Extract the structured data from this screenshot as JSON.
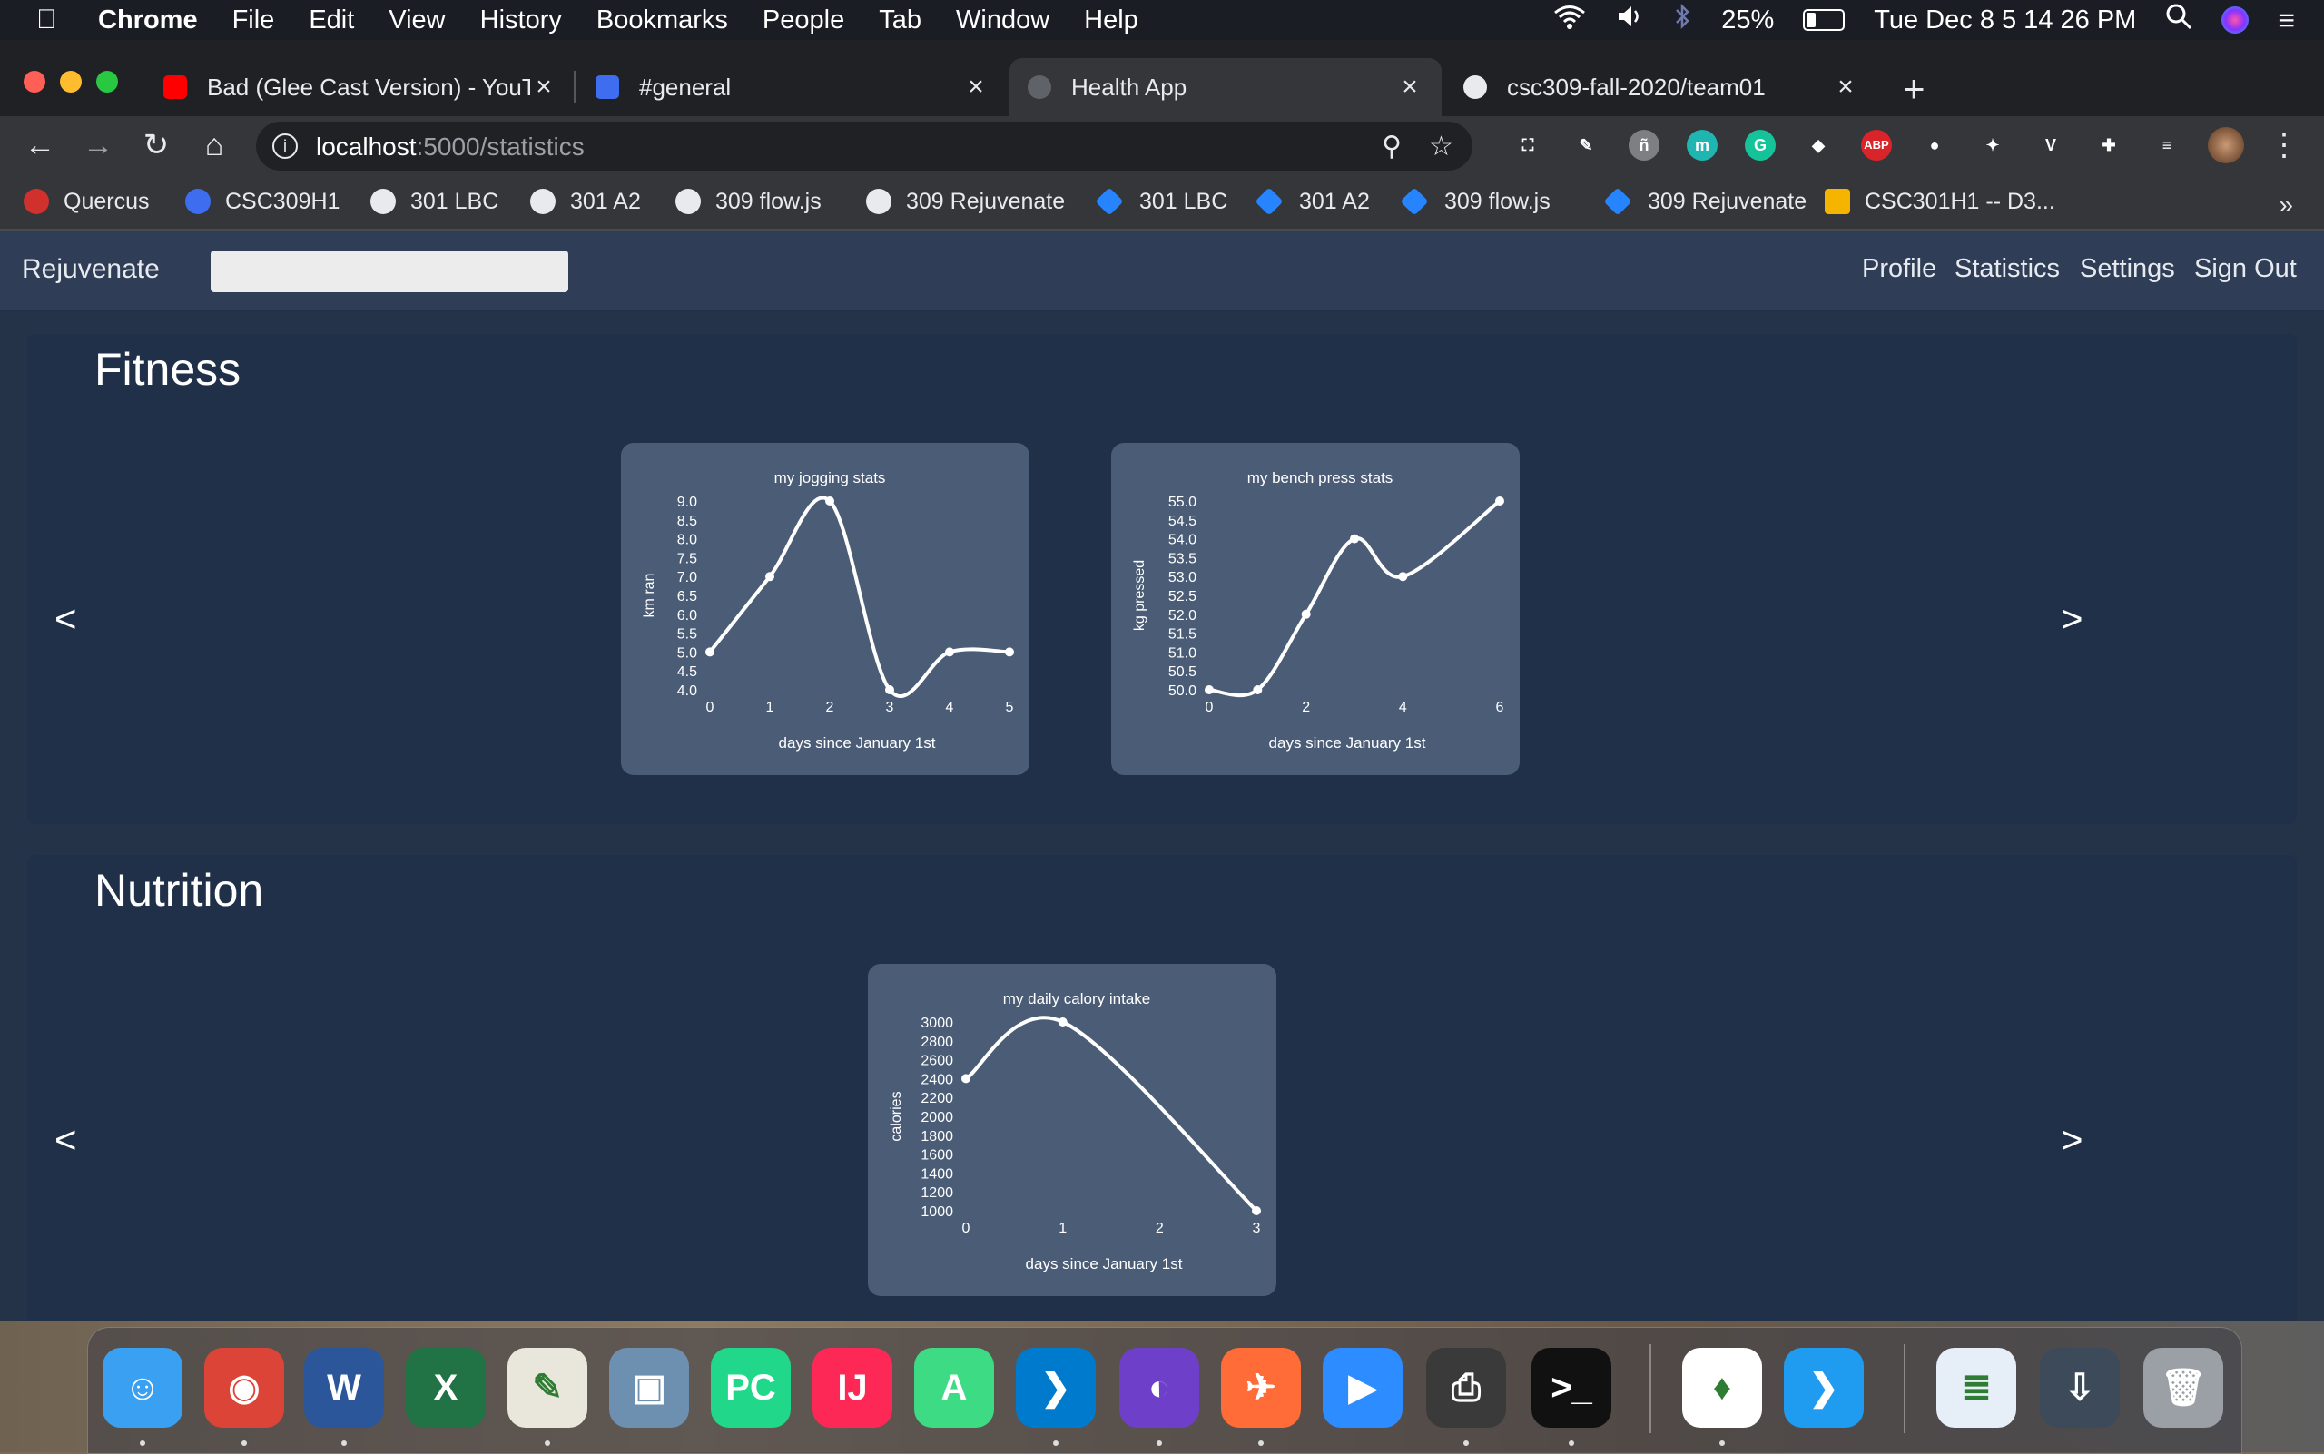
{
  "menubar": {
    "app": "Chrome",
    "items": [
      "File",
      "Edit",
      "View",
      "History",
      "Bookmarks",
      "People",
      "Tab",
      "Window",
      "Help"
    ],
    "battery_pct": "25%",
    "battery_level": 0.25,
    "datetime": "Tue Dec 8  5 14 26 PM"
  },
  "tabs": [
    {
      "title": "Bad (Glee Cast Version) - YouTube",
      "icon": "youtube-icon",
      "color": "#ff0000"
    },
    {
      "title": "#general",
      "icon": "slack-icon",
      "color": "#3f6df0"
    },
    {
      "title": "Health App",
      "icon": "globe-icon",
      "color": "#5f6368"
    },
    {
      "title": "csc309-fall-2020/team01",
      "icon": "github-icon",
      "color": "#e8eaed"
    }
  ],
  "omnibox": {
    "host": "localhost",
    "path": ":5000/statistics"
  },
  "extensions": [
    {
      "icon": "screenshot-ext-icon",
      "label": "⛶",
      "color": "#35363a"
    },
    {
      "icon": "pencil-ext-icon",
      "label": "✎",
      "color": "#35363a"
    },
    {
      "icon": "ext-tile-icon",
      "label": "ñ",
      "color": "#7d7f83"
    },
    {
      "icon": "mendeley-ext-icon",
      "label": "m",
      "color": "#1fb5b0"
    },
    {
      "icon": "grammarly-ext-icon",
      "label": "G",
      "color": "#15c39a"
    },
    {
      "icon": "diamond-ext-icon",
      "label": "◆",
      "color": "#35363a"
    },
    {
      "icon": "adblock-ext-icon",
      "label": "ABP",
      "color": "#d9252a"
    },
    {
      "icon": "toggle-ext-icon",
      "label": "●",
      "color": "#35363a"
    },
    {
      "icon": "react-devtools-icon",
      "label": "✦",
      "color": "#35363a"
    },
    {
      "icon": "vue-devtools-icon",
      "label": "V",
      "color": "#35363a"
    },
    {
      "icon": "puzzle-icon",
      "label": "✚",
      "color": "#35363a"
    },
    {
      "icon": "media-control-icon",
      "label": "≡",
      "color": "#35363a"
    }
  ],
  "bookmarks": [
    {
      "label": "Quercus",
      "icon": "quercus-icon",
      "kind": "dot",
      "color": "#d0312d"
    },
    {
      "label": "CSC309H1",
      "icon": "piazza-icon",
      "kind": "dot",
      "color": "#3f6df0"
    },
    {
      "label": "301 LBC",
      "icon": "github-icon",
      "kind": "gh"
    },
    {
      "label": "301 A2",
      "icon": "github-icon",
      "kind": "gh"
    },
    {
      "label": "309 flow.js",
      "icon": "github-icon",
      "kind": "gh"
    },
    {
      "label": "309 Rejuvenate",
      "icon": "github-icon",
      "kind": "gh"
    },
    {
      "label": "301 LBC",
      "icon": "jira-icon",
      "kind": "jira"
    },
    {
      "label": "301 A2",
      "icon": "jira-icon",
      "kind": "jira"
    },
    {
      "label": "309 flow.js",
      "icon": "jira-icon",
      "kind": "jira"
    },
    {
      "label": "309 Rejuvenate",
      "icon": "jira-icon",
      "kind": "jira"
    },
    {
      "label": "CSC301H1 -- D3...",
      "icon": "slides-icon",
      "kind": "slides",
      "color": "#f4b400"
    }
  ],
  "app": {
    "brand": "Rejuvenate",
    "nav": [
      "Profile",
      "Statistics",
      "Settings",
      "Sign Out"
    ]
  },
  "sections": {
    "fitness": {
      "title": "Fitness",
      "prev": "<",
      "next": ">"
    },
    "nutrition": {
      "title": "Nutrition",
      "prev": "<",
      "next": ">"
    }
  },
  "chart_data": [
    {
      "type": "line",
      "title": "my jogging stats",
      "xlabel": "days since January 1st",
      "ylabel": "km ran",
      "x": [
        0,
        1,
        2,
        3,
        4,
        5
      ],
      "y": [
        5.0,
        7.0,
        9.0,
        4.0,
        5.0,
        5.0
      ],
      "xlim": [
        0,
        5
      ],
      "ylim": [
        4.0,
        9.0
      ],
      "xticks": [
        "0",
        "1",
        "2",
        "3",
        "4",
        "5"
      ],
      "yticks": [
        "9.0",
        "8.5",
        "8.0",
        "7.5",
        "7.0",
        "6.5",
        "6.0",
        "5.5",
        "5.0",
        "4.5",
        "4.0"
      ],
      "line_color": "#ffffff",
      "grid": false
    },
    {
      "type": "line",
      "title": "my bench press stats",
      "xlabel": "days since January 1st",
      "ylabel": "kg pressed",
      "x": [
        0,
        1,
        2,
        3,
        4,
        6
      ],
      "y": [
        50.0,
        50.0,
        52.0,
        54.0,
        53.0,
        55.0
      ],
      "xlim": [
        0,
        6
      ],
      "ylim": [
        50.0,
        55.0
      ],
      "xticks": [
        "0",
        "2",
        "4",
        "6"
      ],
      "yticks": [
        "55.0",
        "54.5",
        "54.0",
        "53.5",
        "53.0",
        "52.5",
        "52.0",
        "51.5",
        "51.0",
        "50.5",
        "50.0"
      ],
      "line_color": "#ffffff",
      "grid": false
    },
    {
      "type": "line",
      "title": "my daily calory intake",
      "xlabel": "days since January 1st",
      "ylabel": "calories",
      "x": [
        0,
        1,
        3
      ],
      "y": [
        2400,
        3000,
        1000
      ],
      "xlim": [
        0,
        3
      ],
      "ylim": [
        1000,
        3000
      ],
      "xticks": [
        "0",
        "1",
        "2",
        "3"
      ],
      "yticks": [
        "3000",
        "2800",
        "2600",
        "2400",
        "2200",
        "2000",
        "1800",
        "1600",
        "1400",
        "1200",
        "1000"
      ],
      "line_color": "#ffffff",
      "grid": false
    }
  ],
  "dock": [
    {
      "name": "finder-icon",
      "label": "☺",
      "color": "#3aa0f2",
      "running": true
    },
    {
      "name": "chrome-icon",
      "label": "◉",
      "color": "#db4437",
      "running": true
    },
    {
      "name": "word-icon",
      "label": "W",
      "color": "#2b579a",
      "running": true
    },
    {
      "name": "excel-icon",
      "label": "X",
      "color": "#217346",
      "running": false
    },
    {
      "name": "textedit-icon",
      "label": "✎",
      "color": "#e9e6dc",
      "running": true
    },
    {
      "name": "preview-icon",
      "label": "▣",
      "color": "#6d8fb0",
      "running": false
    },
    {
      "name": "pycharm-icon",
      "label": "PC",
      "color": "#21d789",
      "running": false
    },
    {
      "name": "intellij-icon",
      "label": "IJ",
      "color": "#fe2857",
      "running": false
    },
    {
      "name": "android-studio-icon",
      "label": "A",
      "color": "#3ddc84",
      "running": false
    },
    {
      "name": "vscode-icon",
      "label": "❯",
      "color": "#007acc",
      "running": true
    },
    {
      "name": "github-desktop-icon",
      "label": "◐",
      "color": "#6e40c9",
      "running": true
    },
    {
      "name": "postman-icon",
      "label": "✈",
      "color": "#ff6c37",
      "running": true
    },
    {
      "name": "zoom-icon",
      "label": "▶",
      "color": "#2d8cff",
      "running": false
    },
    {
      "name": "printer-icon",
      "label": "⎙",
      "color": "#3a3a3a",
      "running": true
    },
    {
      "name": "terminal-icon",
      "label": ">_",
      "color": "#111111",
      "running": true
    },
    {
      "name": "mongodb-compass-icon",
      "label": "♦",
      "color": "#ffffff",
      "running": true
    },
    {
      "name": "vscode-insiders-icon",
      "label": "❯",
      "color": "#1f9cf0",
      "running": false
    },
    {
      "name": "document-stack-icon",
      "label": "≣",
      "color": "#e6eef8",
      "running": false
    },
    {
      "name": "downloads-stack-icon",
      "label": "⇩",
      "color": "#3c4a5a",
      "running": false
    },
    {
      "name": "trash-icon",
      "label": "🗑",
      "color": "#9aa0a6",
      "running": false
    }
  ]
}
